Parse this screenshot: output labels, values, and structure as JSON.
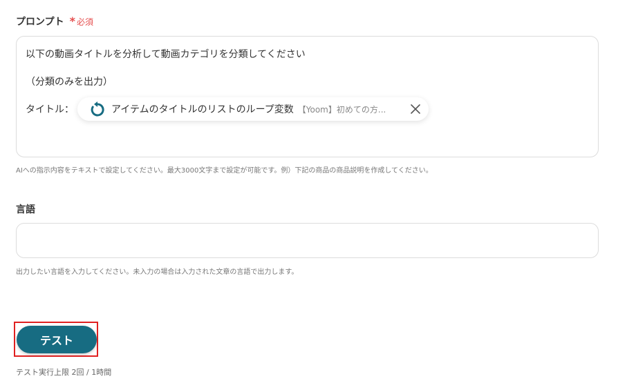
{
  "prompt_field": {
    "label": "プロンプト",
    "required_mark": "*",
    "required_text": "必須",
    "lines": [
      "以下の動画タイトルを分析して動画カテゴリを分類してください",
      "（分類のみを出力）",
      "タイトル："
    ],
    "chip": {
      "icon": "loop-arrow-icon",
      "main_text": "アイテムのタイトルのリストのループ変数",
      "sub_text": "【Yoom】初めての方...",
      "close_icon": "close-icon"
    },
    "help_text": "AIへの指示内容をテキストで設定してください。最大3000文字まで設定が可能です。例）下記の商品の商品説明を作成してください。"
  },
  "language_field": {
    "label": "言語",
    "value": "",
    "help_text": "出力したい言語を入力してください。未入力の場合は入力された文章の言語で出力します。"
  },
  "test_button": {
    "label": "テスト"
  },
  "test_limit_text": "テスト実行上限 2回 / 1時間",
  "colors": {
    "accent": "#176c82",
    "required": "#e54d4d",
    "highlight": "#e02020"
  }
}
